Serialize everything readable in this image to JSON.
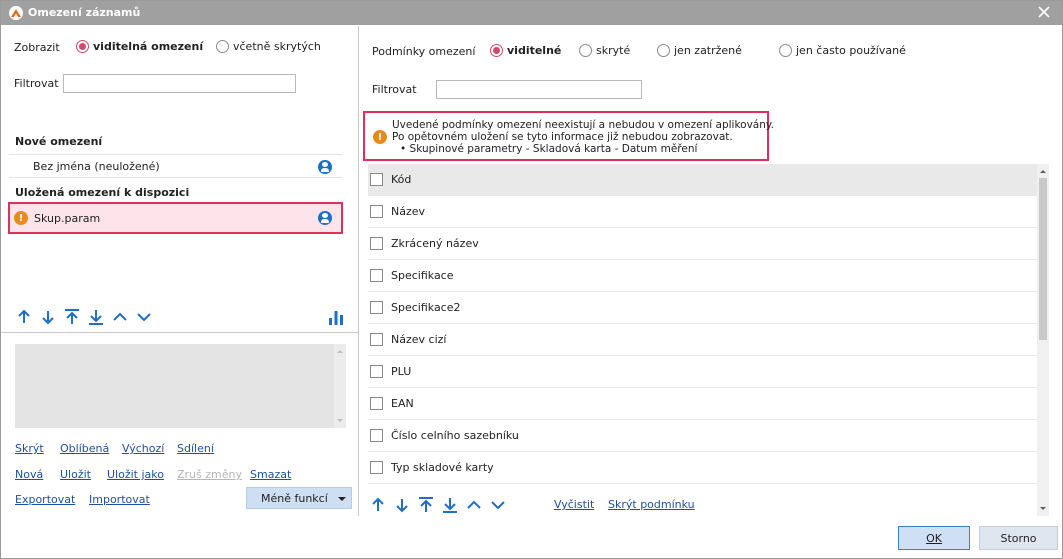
{
  "window": {
    "title": "Omezení záznamů",
    "close_icon": "close-icon",
    "app_icon": "app-logo-icon"
  },
  "left": {
    "show_label": "Zobrazit",
    "show_options": [
      {
        "label": "viditelná omezení",
        "selected": true
      },
      {
        "label": "včetně skrytých",
        "selected": false
      }
    ],
    "filter_label": "Filtrovat",
    "filter_value": "",
    "new_section": "Nové omezení",
    "new_items": [
      {
        "label": "Bez jména (neuložené)",
        "icon": "user-icon"
      }
    ],
    "saved_section": "Uložená omezení k dispozici",
    "saved_items": [
      {
        "label": "Skup.param",
        "warning": true,
        "icon": "user-icon",
        "selected": true
      }
    ],
    "move_icons": [
      "arrow-up-icon",
      "arrow-down-icon",
      "arrow-to-top-icon",
      "arrow-to-bottom-icon",
      "chevron-up-icon",
      "chevron-down-icon"
    ],
    "stats_icon": "bar-chart-icon",
    "description_value": "",
    "links_row1": [
      "Skrýt",
      "Oblíbená",
      "Výchozí",
      "Sdílení"
    ],
    "links_row2": [
      "Nová",
      "Uložit",
      "Uložit jako",
      "Zruš změny",
      "Smazat"
    ],
    "links_row3": [
      "Exportovat",
      "Importovat"
    ],
    "less_functions": "Méně funkcí"
  },
  "right": {
    "conditions_label": "Podmínky omezení",
    "condition_options": [
      {
        "label": "viditelné",
        "selected": true
      },
      {
        "label": "skryté",
        "selected": false
      },
      {
        "label": "jen zatržené",
        "selected": false
      },
      {
        "label": "jen často používané",
        "selected": false
      }
    ],
    "filter_label": "Filtrovat",
    "filter_value": "",
    "warning": {
      "icon": "warning-icon",
      "line1": "Uvedené podmínky omezení neexistují a nebudou v omezení aplikovány.",
      "line2": "Po opětovném uložení se tyto informace již nebudou zobrazovat.",
      "line3": "• Skupinové parametry - Skladová karta - Datum měření"
    },
    "fields": [
      "Kód",
      "Název",
      "Zkrácený název",
      "Specifikace",
      "Specifikace2",
      "Název cizí",
      "PLU",
      "EAN",
      "Číslo celního sazebníku",
      "Typ skladové karty"
    ],
    "links": [
      "Vyčistit",
      "Skrýt podmínku"
    ]
  },
  "footer": {
    "ok": "OK",
    "cancel": "Storno"
  },
  "colors": {
    "accent": "#d04a6a",
    "link": "#1f4f9f",
    "icon_blue": "#1f6fc5",
    "warning": "#e98a1c",
    "highlight_border": "#e0305a",
    "selected_bg": "#fde4ea"
  }
}
